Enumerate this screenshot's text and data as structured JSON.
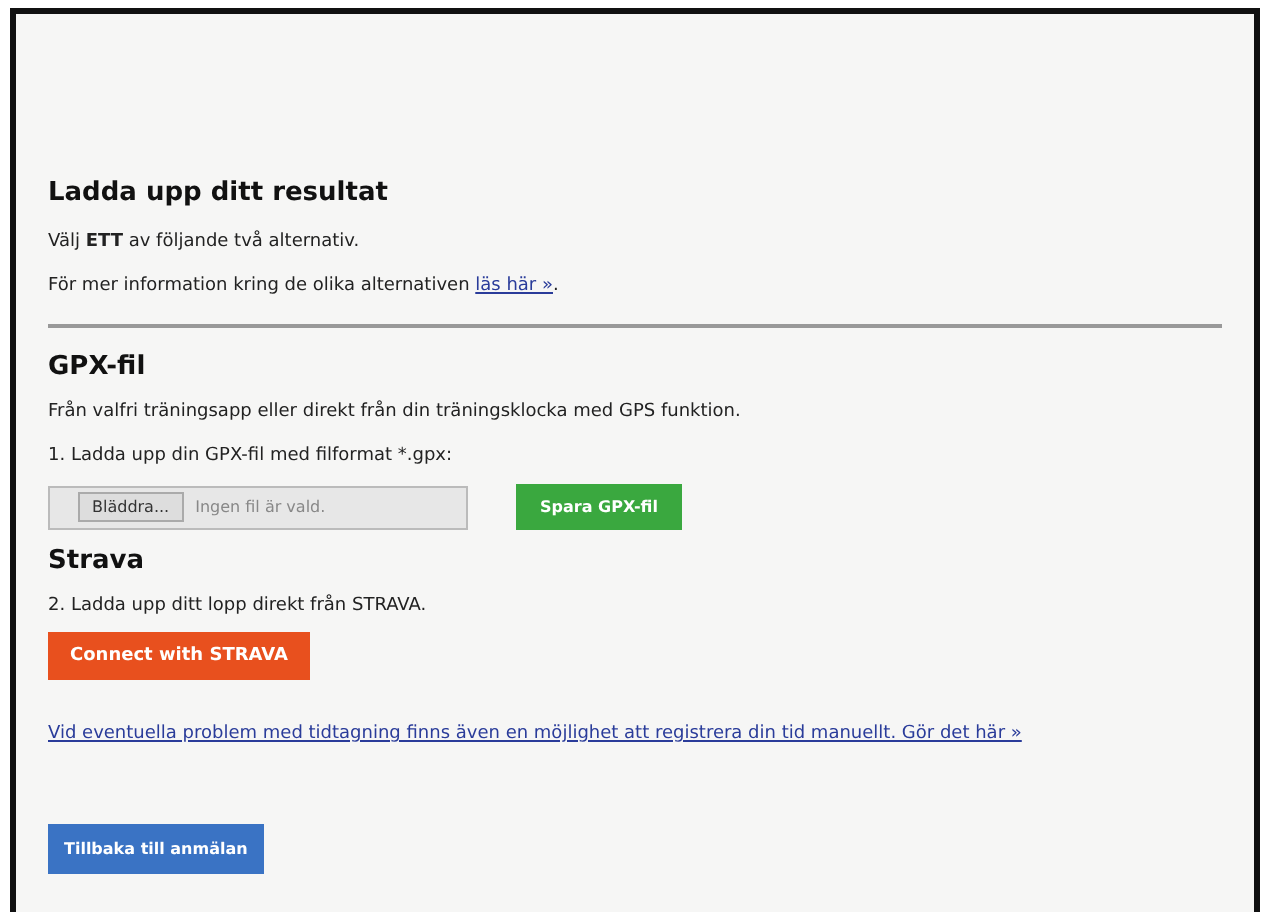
{
  "title": "Ladda upp ditt resultat",
  "intro": [
    "Välj **ETT** av följande två alternativ."
  ],
  "info": {
    "text": "För mer information kring de olika alternativen ",
    "link": "läs här »",
    "after": "."
  },
  "gpx": {
    "heading": "GPX-fil",
    "description": "Från valfri träningsapp eller direkt från din träningsklocka med GPS funktion.",
    "step": "1. Ladda upp din GPX-fil med filformat *.gpx:",
    "browse": "Bläddra...",
    "file_status": "Ingen fil är vald.",
    "save": "Spara GPX-fil"
  },
  "strava": {
    "heading": "Strava",
    "step": "2. Ladda upp ditt lopp direkt från STRAVA.",
    "connect": "Connect with **STRAVA**"
  },
  "manual_link": "Vid eventuella problem med tidtagning finns även en möjlighet att registrera din tid manuellt. Gör det här »",
  "back": "Tillbaka till anmälan"
}
